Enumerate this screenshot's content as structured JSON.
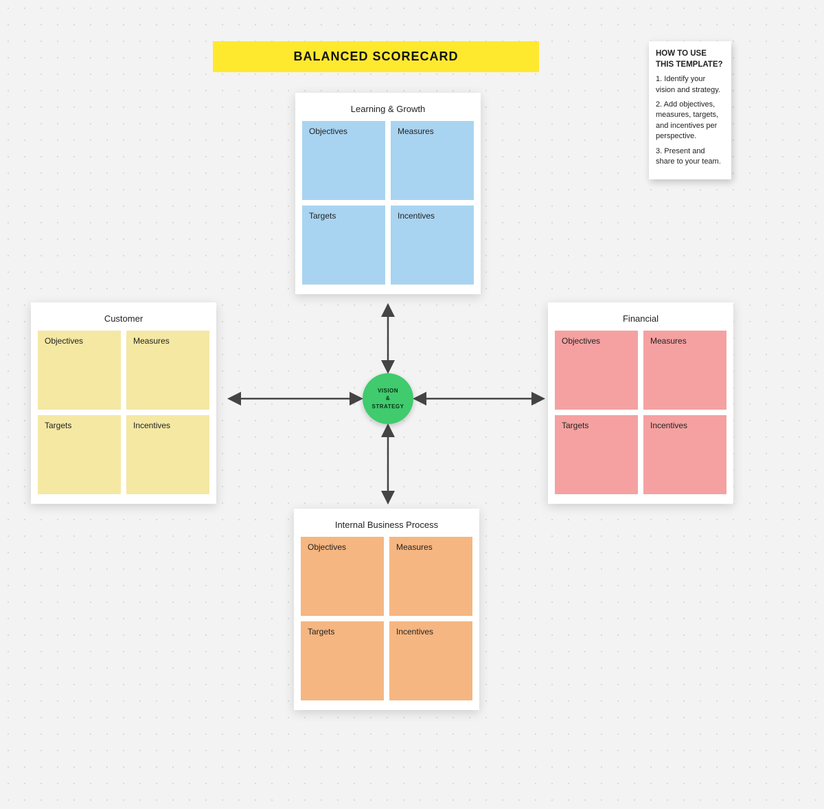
{
  "title": "BALANCED SCORECARD",
  "help": {
    "heading": "HOW TO USE THIS TEMPLATE?",
    "step1": "1. Identify your vision and strategy.",
    "step2": "2. Add objectives, measures, targets, and incentives per perspective.",
    "step3": "3. Present and share to your team."
  },
  "center": {
    "line1": "VISION",
    "line2": "&",
    "line3": "STRATEGY"
  },
  "panels": {
    "top": {
      "title": "Learning & Growth",
      "tiles": [
        "Objectives",
        "Measures",
        "Targets",
        "Incentives"
      ]
    },
    "left": {
      "title": "Customer",
      "tiles": [
        "Objectives",
        "Measures",
        "Targets",
        "Incentives"
      ]
    },
    "right": {
      "title": "Financial",
      "tiles": [
        "Objectives",
        "Measures",
        "Targets",
        "Incentives"
      ]
    },
    "bottom": {
      "title": "Internal Business Process",
      "tiles": [
        "Objectives",
        "Measures",
        "Targets",
        "Incentives"
      ]
    }
  }
}
